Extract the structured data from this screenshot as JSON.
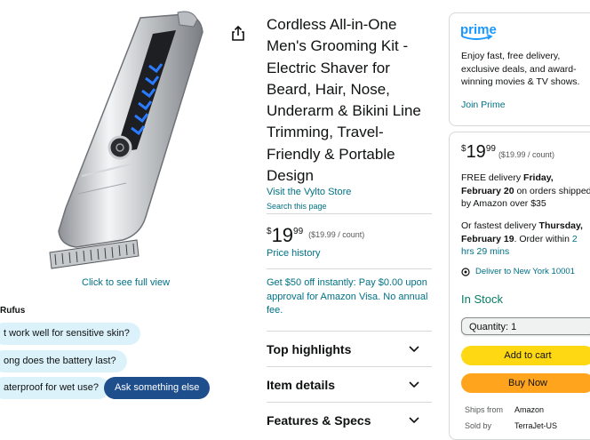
{
  "image": {
    "see_full_view": "Click to see full view"
  },
  "rufus": {
    "label": "Rufus",
    "chips": [
      "t work well for sensitive skin?",
      "ong does the battery last?",
      "aterproof for wet use?"
    ],
    "ask_button": "Ask something else"
  },
  "product": {
    "title": "Cordless All-in-One Men's Grooming Kit - Electric Shaver for Beard, Hair, Nose, Underarm & Bikini Line Trimming, Travel-Friendly & Portable Design",
    "store_link": "Visit the Vylto Store",
    "search_page": "Search this page",
    "price": {
      "symbol": "$",
      "whole": "19",
      "fraction": "99",
      "unit": "($19.99 / count)"
    },
    "price_history": "Price history",
    "promo": "Get $50 off instantly: Pay $0.00 upon approval for Amazon Visa. No annual fee."
  },
  "accordion": [
    {
      "label": "Top highlights"
    },
    {
      "label": "Item details"
    },
    {
      "label": "Features & Specs"
    }
  ],
  "prime_panel": {
    "logo_text": "prime",
    "text": "Enjoy fast, free delivery, exclusive deals, and award-winning movies & TV shows.",
    "join": "Join Prime"
  },
  "buy_box": {
    "price_symbol": "$",
    "price_whole": "19",
    "price_fraction": "99",
    "price_unit": "($19.99 / count)",
    "delivery_prefix": "FREE delivery ",
    "delivery_date": "Friday, February 20",
    "delivery_suffix": " on orders shipped by Amazon over $35",
    "fastest_prefix": "Or fastest delivery ",
    "fastest_date": "Thursday, February 19",
    "fastest_mid": ". Order within ",
    "fastest_time": "2 hrs 29 mins",
    "deliver_to": "Deliver to New York 10001",
    "stock": "In Stock",
    "quantity": "Quantity: 1",
    "add_to_cart": "Add to cart",
    "buy_now": "Buy Now",
    "ships_from_label": "Ships from",
    "ships_from_value": "Amazon",
    "sold_by_label": "Sold by",
    "sold_by_value": "TerraJet-US"
  },
  "colors": {
    "link": "#007185",
    "stock_green": "#067d62",
    "cart_yellow": "#ffd814",
    "buy_orange": "#ffa41c",
    "prime_blue": "#1a98ff",
    "rufus_chip": "#dbf2fb",
    "ask_button": "#1f4e8c"
  }
}
